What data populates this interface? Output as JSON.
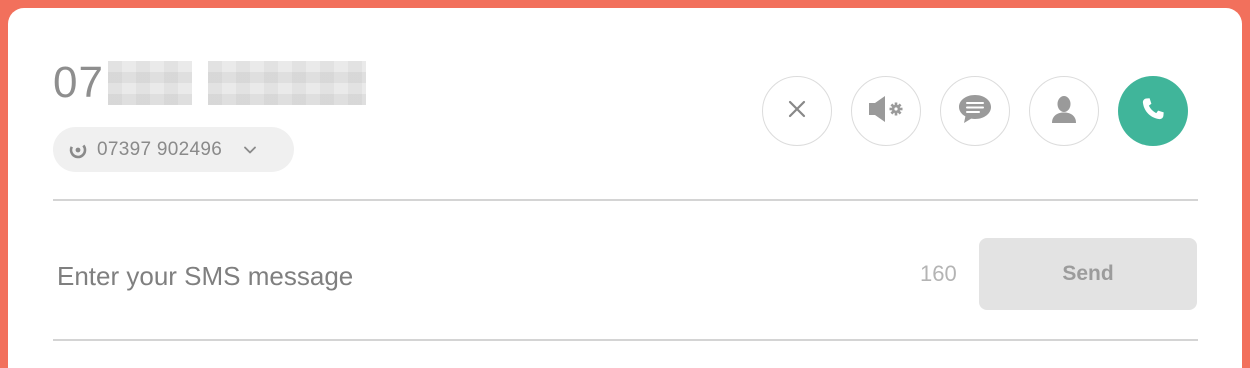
{
  "contact": {
    "number_visible_prefix": "07"
  },
  "caller_id": {
    "number": "07397 902496",
    "icon": "caller-id-icon",
    "dropdown_icon": "chevron-down-icon"
  },
  "actions": [
    {
      "name": "close",
      "icon": "close-icon"
    },
    {
      "name": "speaker-settings",
      "icon": "speaker-settings-icon"
    },
    {
      "name": "sms",
      "icon": "chat-bubble-icon"
    },
    {
      "name": "contact",
      "icon": "person-icon"
    },
    {
      "name": "call",
      "icon": "phone-icon"
    }
  ],
  "sms": {
    "placeholder": "Enter your SMS message",
    "value": "",
    "char_count": "160",
    "send_label": "Send"
  },
  "colors": {
    "background_accent": "#f2705c",
    "call_button": "#40b59a",
    "send_button_disabled": "#e3e3e3"
  }
}
